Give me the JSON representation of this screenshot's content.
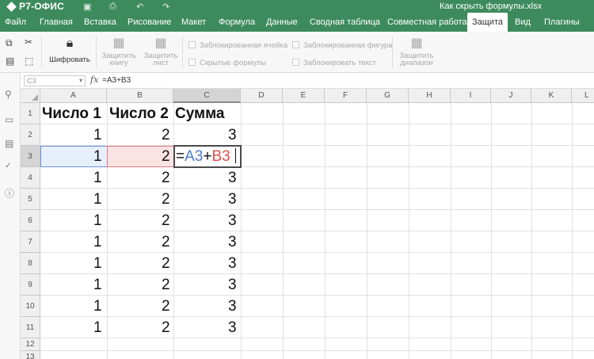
{
  "app": {
    "logo": "Р7-ОФИС",
    "doc_title": "Как скрыть формулы.xlsx"
  },
  "menu": {
    "tabs": [
      "Файл",
      "Главная",
      "Вставка",
      "Рисование",
      "Макет",
      "Формула",
      "Данные",
      "Сводная таблица",
      "Совместная работа",
      "Защита",
      "Вид",
      "Плагины"
    ],
    "active": "Защита"
  },
  "ribbon": {
    "encrypt": "Шифровать",
    "protect_book_1": "Защитить",
    "protect_book_2": "книгу",
    "protect_sheet_1": "Защитить",
    "protect_sheet_2": "лист",
    "locked_cell": "Заблокированная ячейка",
    "hidden_formulas": "Скрытые формулы",
    "locked_shape": "Заблокированная фигура",
    "lock_text": "Заблокировать текст",
    "protect_range_1": "Защитить",
    "protect_range_2": "диапазон"
  },
  "formula_bar": {
    "name_box": "C3",
    "fx": "fx",
    "value": "=A3+B3"
  },
  "grid": {
    "columns": [
      "A",
      "B",
      "C",
      "D",
      "E",
      "F",
      "G",
      "H",
      "I",
      "J",
      "K",
      "L"
    ],
    "rows": [
      "1",
      "2",
      "3",
      "4",
      "5",
      "6",
      "7",
      "8",
      "9",
      "10",
      "11",
      "12",
      "13"
    ],
    "headers": [
      "Число 1",
      "Число 2",
      "Сумма"
    ],
    "a_values": [
      "1",
      "1",
      "1",
      "1",
      "1",
      "1",
      "1",
      "1",
      "1",
      "1"
    ],
    "b_values": [
      "2",
      "2",
      "2",
      "2",
      "2",
      "2",
      "2",
      "2",
      "2",
      "2"
    ],
    "c_values": [
      "3",
      "",
      "3",
      "3",
      "3",
      "3",
      "3",
      "3",
      "3",
      "3"
    ],
    "edit": {
      "eq": "=",
      "ref1": "A3",
      "plus": "+",
      "ref2": "B3"
    }
  },
  "colors": {
    "brand": "#3d8b5c",
    "ref_a": "#4e79d0",
    "ref_b": "#e24d4d"
  },
  "icons": {
    "sidebar": [
      "search-icon",
      "comment-icon",
      "chat-icon",
      "spellcheck-icon",
      "info-icon"
    ]
  }
}
